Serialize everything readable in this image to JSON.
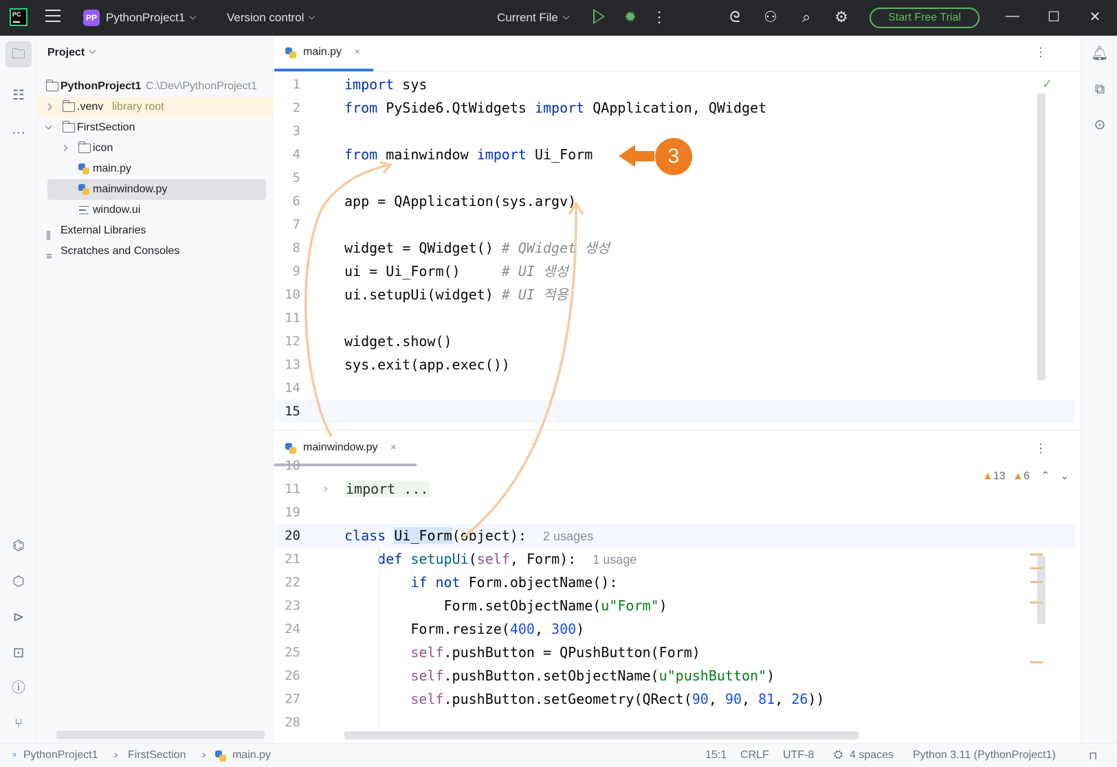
{
  "titlebar": {
    "logo_text": "PC",
    "project_badge": "PP",
    "project_name": "PythonProject1",
    "version_control": "Version control",
    "run_config": "Current File",
    "trial_button": "Start Free Trial",
    "icons": [
      "run-icon",
      "debug-icon",
      "more-icon",
      "ai-assistant-icon",
      "add-user-icon",
      "search-icon",
      "settings-icon"
    ]
  },
  "project_panel": {
    "title": "Project",
    "tree": {
      "root": {
        "name": "PythonProject1",
        "path": "C:\\Dev\\PythonProject1"
      },
      "venv": {
        "name": ".venv",
        "note": "library root"
      },
      "first_section": "FirstSection",
      "icon_folder": "icon",
      "main_py": "main.py",
      "mainwindow_py": "mainwindow.py",
      "window_ui": "window.ui",
      "external_libraries": "External Libraries",
      "scratches": "Scratches and Consoles"
    }
  },
  "editor_top": {
    "tab_label": "main.py",
    "tab_close": "×",
    "kebab": "⋮",
    "lines": {
      "n1": "1",
      "n2": "2",
      "n3": "3",
      "n4": "4",
      "n5": "5",
      "n6": "6",
      "n7": "7",
      "n8": "8",
      "n9": "9",
      "n10": "10",
      "n11": "11",
      "n12": "12",
      "n13": "13",
      "n14": "14",
      "n15": "15",
      "l1_kw": "import",
      "l1_rest": " sys",
      "l2_kw1": "from",
      "l2_mid": " PySide6.QtWidgets ",
      "l2_kw2": "import",
      "l2_rest": " QApplication, QWidget",
      "l4_kw1": "from",
      "l4_mid": " mainwindow ",
      "l4_kw2": "import",
      "l4_rest": " Ui_Form",
      "l6": "app = QApplication(sys.argv)",
      "l8_code": "widget = QWidget() ",
      "l8_cm": "# QWidget 생성",
      "l9_code": "ui = Ui_Form()     ",
      "l9_cm": "# UI 생성",
      "l10_code": "ui.setupUi(widget) ",
      "l10_cm": "# UI 적용",
      "l12": "widget.show()",
      "l13": "sys.exit(app.exec())"
    }
  },
  "editor_bottom": {
    "tab_label": "mainwindow.py",
    "tab_close": "×",
    "kebab": "⋮",
    "warnings": "13",
    "weak_warnings": "6",
    "lines": {
      "n10": "10",
      "n11": "11",
      "n19": "19",
      "n20": "20",
      "n21": "21",
      "n22": "22",
      "n23": "23",
      "n24": "24",
      "n25": "25",
      "n26": "26",
      "n27": "27",
      "n28": "28",
      "l11_fold": "import ...",
      "l20_kw": "class",
      "l20_name": "Ui_Form",
      "l20_rest": "(object):",
      "l20_usages": "2 usages",
      "l21_kw": "def",
      "l21_fn": "setupUi",
      "l21_p": "(",
      "l21_self": "self",
      "l21_rest": ", Form):",
      "l21_usages": "1 usage",
      "l22_kw": "if not",
      "l22_rest": " Form.objectName():",
      "l23_pre": "Form.setObjectName(",
      "l23_str": "u\"Form\"",
      "l23_post": ")",
      "l24_pre": "Form.resize(",
      "l24_n1": "400",
      "l24_mid": ", ",
      "l24_n2": "300",
      "l24_post": ")",
      "l25_self": "self",
      "l25_rest": ".pushButton = QPushButton(Form)",
      "l26_self": "self",
      "l26_pre": ".pushButton.setObjectName(",
      "l26_str": "u\"pushButton\"",
      "l26_post": ")",
      "l27_self": "self",
      "l27_pre": ".pushButton.setGeometry(QRect(",
      "l27_n1": "90",
      "l27_s1": ", ",
      "l27_n2": "90",
      "l27_s2": ", ",
      "l27_n3": "81",
      "l27_s3": ", ",
      "l27_n4": "26",
      "l27_post": "))"
    }
  },
  "annotation": {
    "step_number": "3",
    "color": "#ee7d22"
  },
  "statusbar": {
    "breadcrumb_project": "PythonProject1",
    "breadcrumb_folder": "FirstSection",
    "breadcrumb_file": "main.py",
    "position": "15:1",
    "line_ending": "CRLF",
    "encoding": "UTF-8",
    "indent": "4 spaces",
    "interpreter": "Python 3.11 (PythonProject1)"
  },
  "colors": {
    "accent": "#3574f0",
    "keyword": "#0033b3",
    "string": "#067d17",
    "number": "#1750eb",
    "self": "#94558d",
    "trial_green": "#5fb865"
  }
}
